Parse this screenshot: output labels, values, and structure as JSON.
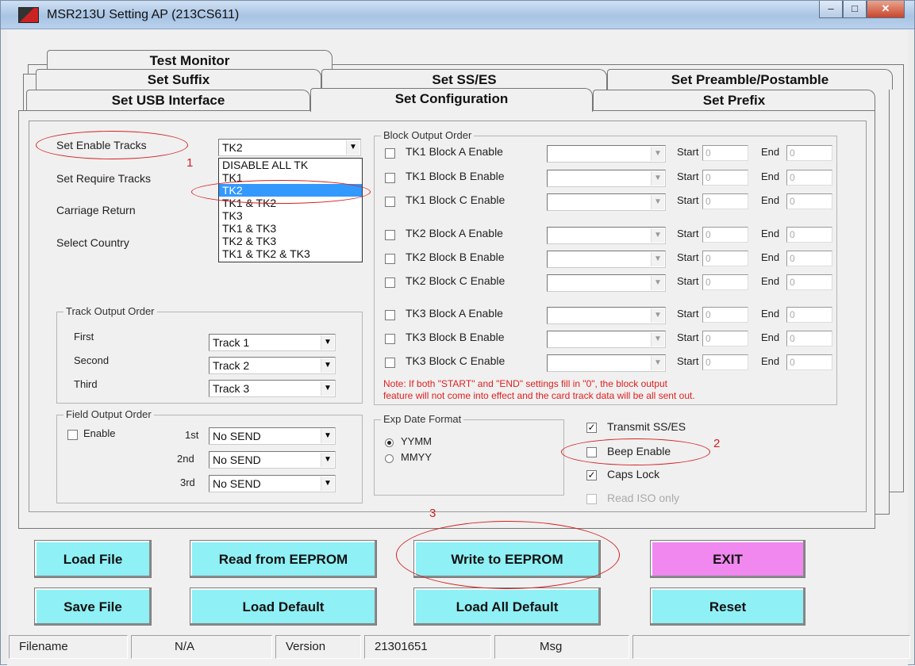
{
  "window": {
    "title": "MSR213U Setting AP (213CS611)",
    "min": "–",
    "max": "□",
    "close": "✕"
  },
  "tabs": {
    "row3": [
      "Test Monitor"
    ],
    "row2": [
      "Set Suffix",
      "Set SS/ES",
      "Set Preamble/Postamble"
    ],
    "row1": [
      "Set USB Interface",
      "Set Configuration",
      "Set Prefix"
    ],
    "active": "Set Configuration"
  },
  "left": {
    "enable_tracks_label": "Set Enable Tracks",
    "enable_tracks_value": "TK2",
    "require_tracks_label": "Set Require Tracks",
    "carriage_return_label": "Carriage Return",
    "select_country_label": "Select Country",
    "dropdown_options": [
      "DISABLE ALL TK",
      "TK1",
      "TK2",
      "TK1 & TK2",
      "TK3",
      "TK1 & TK3",
      "TK2 & TK3",
      "TK1 & TK2 & TK3"
    ],
    "dropdown_selected": "TK2"
  },
  "track_output": {
    "title": "Track Output Order",
    "rows": [
      {
        "label": "First",
        "value": "Track 1"
      },
      {
        "label": "Second",
        "value": "Track 2"
      },
      {
        "label": "Third",
        "value": "Track 3"
      }
    ]
  },
  "field_output": {
    "title": "Field Output Order",
    "enable_label": "Enable",
    "rows": [
      {
        "label": "1st",
        "value": "No SEND"
      },
      {
        "label": "2nd",
        "value": "No SEND"
      },
      {
        "label": "3rd",
        "value": "No SEND"
      }
    ]
  },
  "block": {
    "title": "Block Output Order",
    "start_label": "Start",
    "end_label": "End",
    "rows": [
      {
        "label": "TK1 Block A Enable",
        "start": "0",
        "end": "0"
      },
      {
        "label": "TK1 Block B Enable",
        "start": "0",
        "end": "0"
      },
      {
        "label": "TK1 Block C Enable",
        "start": "0",
        "end": "0"
      },
      {
        "label": "TK2 Block A Enable",
        "start": "0",
        "end": "0"
      },
      {
        "label": "TK2 Block B Enable",
        "start": "0",
        "end": "0"
      },
      {
        "label": "TK2 Block C Enable",
        "start": "0",
        "end": "0"
      },
      {
        "label": "TK3 Block A Enable",
        "start": "0",
        "end": "0"
      },
      {
        "label": "TK3 Block B Enable",
        "start": "0",
        "end": "0"
      },
      {
        "label": "TK3 Block C Enable",
        "start": "0",
        "end": "0"
      }
    ],
    "note_line1": "Note: If both \"START\" and \"END\" settings fill in \"0\", the block output",
    "note_line2": "feature will not come into effect and the card track data will be all sent out."
  },
  "exp_date": {
    "title": "Exp Date Format",
    "options": [
      "YYMM",
      "MMYY"
    ],
    "selected": "YYMM"
  },
  "options": {
    "transmit_ss_es": "Transmit SS/ES",
    "beep_enable": "Beep Enable",
    "caps_lock": "Caps Lock",
    "read_iso_only": "Read ISO only"
  },
  "annotations": {
    "a1": "1",
    "a2": "2",
    "a3": "3"
  },
  "buttons": {
    "load_file": "Load File",
    "read_eeprom": "Read from EEPROM",
    "write_eeprom": "Write to EEPROM",
    "exit": "EXIT",
    "save_file": "Save File",
    "load_default": "Load Default",
    "load_all_default": "Load  All Default",
    "reset": "Reset"
  },
  "status": {
    "filename_label": "Filename",
    "filename_value": "N/A",
    "version_label": "Version",
    "version_value": "21301651",
    "msg_label": "Msg"
  },
  "colors": {
    "button_cyan": "#8ff0f5",
    "button_pink": "#f088f0",
    "annotation_red": "#d42020",
    "selection_blue": "#3399ff"
  }
}
